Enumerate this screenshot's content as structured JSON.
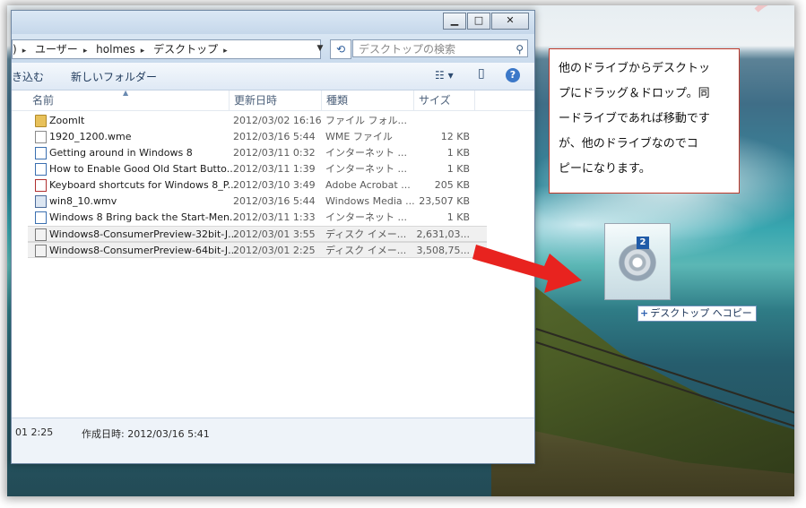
{
  "window": {
    "controls": {
      "minimize": "▁",
      "maximize": "□",
      "close": "✕"
    },
    "address": {
      "segments": [
        ")",
        "ユーザー",
        "holmes",
        "デスクトップ"
      ],
      "separator": "▸",
      "dropdown_icon": "▼"
    },
    "refresh_icon": "⟲",
    "search": {
      "placeholder": "デスクトップの検索"
    },
    "toolbar": {
      "include_label": "き込む",
      "new_folder_label": "新しいフォルダー",
      "view_icon": "☷ ▾",
      "preview_icon": "▯",
      "help_icon": "?"
    },
    "columns": [
      "名前",
      "更新日時",
      "種類",
      "サイズ"
    ],
    "files": [
      {
        "icon": "folder",
        "name": "ZoomIt",
        "date": "2012/03/02 16:16",
        "type": "ファイル フォル...",
        "size": ""
      },
      {
        "icon": "file",
        "name": "1920_1200.wme",
        "date": "2012/03/16 5:44",
        "type": "WME ファイル",
        "size": "12 KB"
      },
      {
        "icon": "link",
        "name": "Getting around in Windows 8",
        "date": "2012/03/11 0:32",
        "type": "インターネット ...",
        "size": "1 KB"
      },
      {
        "icon": "link",
        "name": "How to Enable Good Old Start Butto...",
        "date": "2012/03/11 1:39",
        "type": "インターネット ...",
        "size": "1 KB"
      },
      {
        "icon": "pdf",
        "name": "Keyboard shortcuts for Windows 8_P...",
        "date": "2012/03/10 3:49",
        "type": "Adobe Acrobat ...",
        "size": "205 KB"
      },
      {
        "icon": "wmv",
        "name": "win8_10.wmv",
        "date": "2012/03/16 5:44",
        "type": "Windows Media ...",
        "size": "23,507 KB"
      },
      {
        "icon": "link",
        "name": "Windows 8 Bring back the Start-Men...",
        "date": "2012/03/11 1:33",
        "type": "インターネット ...",
        "size": "1 KB"
      },
      {
        "icon": "iso",
        "name": "Windows8-ConsumerPreview-32bit-J...",
        "date": "2012/03/01 3:55",
        "type": "ディスク イメー...",
        "size": "2,631,03...",
        "selected": true
      },
      {
        "icon": "iso",
        "name": "Windows8-ConsumerPreview-64bit-J...",
        "date": "2012/03/01 2:25",
        "type": "ディスク イメー...",
        "size": "3,508,75...",
        "selected": true
      }
    ],
    "status": {
      "modified": "01 2:25",
      "created": "作成日時: 2012/03/16 5:41"
    }
  },
  "callout": {
    "lines": [
      "他のドライブからデスクトッ",
      "プにドラッグ＆ドロップ。同",
      "ードライブであれば移動です",
      "が、他のドライブなのでコ",
      "ピーになります。"
    ]
  },
  "drag": {
    "badge": "2",
    "plus": "+",
    "tooltip": "デスクトップ へコピー"
  },
  "colors": {
    "arrow": "#e8231f",
    "callout_border": "#c0392b"
  }
}
